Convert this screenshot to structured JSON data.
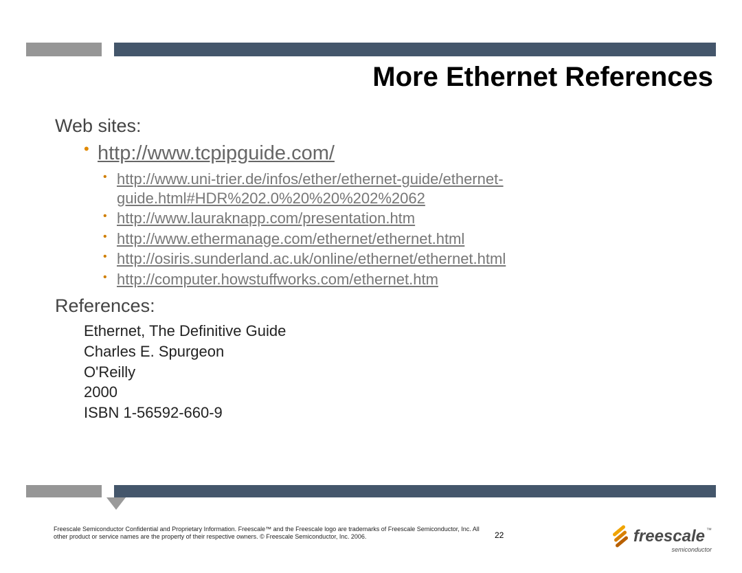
{
  "title": "More Ethernet References",
  "sections": {
    "websites_heading": "Web sites:",
    "link_main": "http://www.tcpipguide.com/",
    "sublinks": [
      "http://www.uni-trier.de/infos/ether/ethernet-guide/ethernet-guide.html#HDR%202.0%20%20%202%2062",
      "http://www.lauraknapp.com/presentation.htm",
      "http://www.ethermanage.com/ethernet/ethernet.html",
      "http://osiris.sunderland.ac.uk/online/ethernet/ethernet.html",
      "http://computer.howstuffworks.com/ethernet.htm"
    ],
    "refs_heading": "References:",
    "ref_lines": [
      "Ethernet, The Definitive Guide",
      "Charles E. Spurgeon",
      "O'Reilly",
      "2000",
      "ISBN 1-56592-660-9"
    ]
  },
  "footer": {
    "legal": "Freescale Semiconductor Confidential and Proprietary Information. Freescale™ and the Freescale logo are trademarks of Freescale Semiconductor, Inc. All other product or service names are the property of their respective owners. © Freescale Semiconductor, Inc. 2006.",
    "page": "22",
    "logo_word": "freescale",
    "logo_tm": "™",
    "logo_sub": "semiconductor"
  }
}
